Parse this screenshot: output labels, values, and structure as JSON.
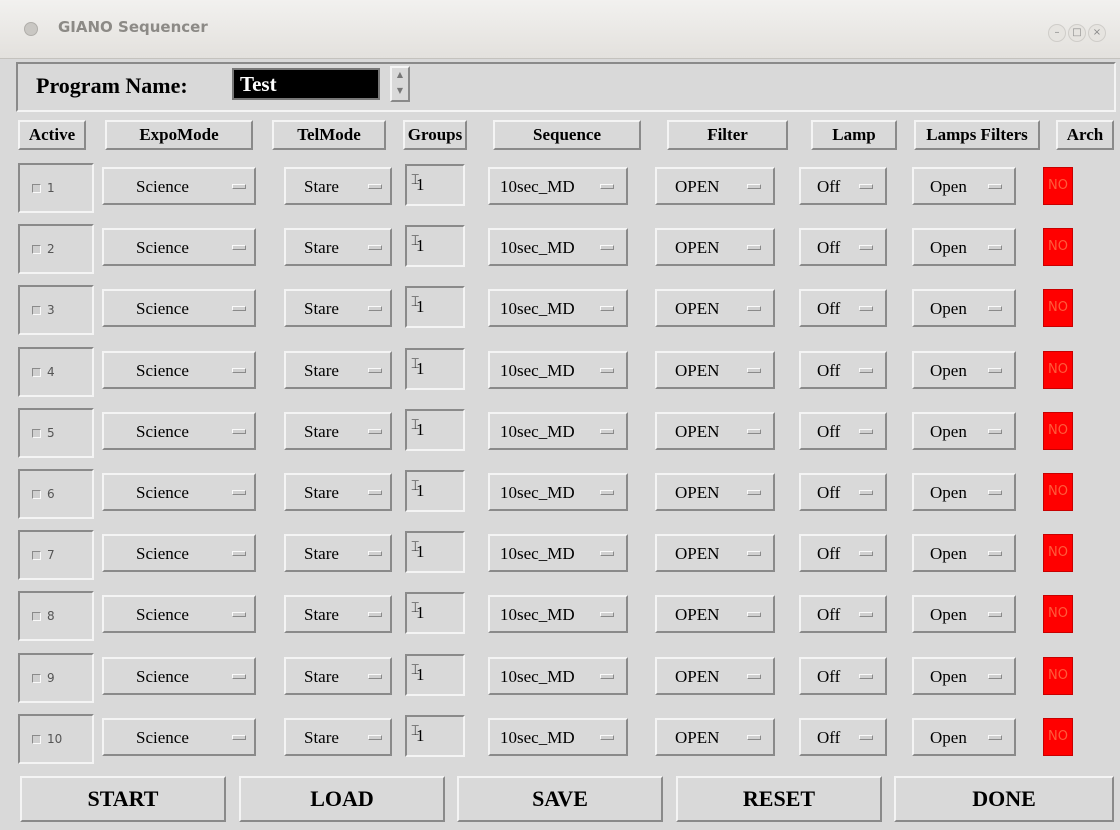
{
  "window": {
    "title": "GIANO Sequencer",
    "controls": [
      "–",
      "□",
      "×"
    ]
  },
  "program": {
    "label": "Program Name:",
    "value": "Test"
  },
  "headers": {
    "active": "Active",
    "expomode": "ExpoMode",
    "telmode": "TelMode",
    "groups": "Groups",
    "sequence": "Sequence",
    "filter": "Filter",
    "lamp": "Lamp",
    "lamps_filters": "Lamps Filters",
    "arch": "Arch"
  },
  "rows": [
    {
      "num": "1",
      "expomode": "Science",
      "telmode": "Stare",
      "groups": "1",
      "sequence": "10sec_MD",
      "filter": "OPEN",
      "lamp": "Off",
      "lamps_filters": "Open",
      "arch": "NO"
    },
    {
      "num": "2",
      "expomode": "Science",
      "telmode": "Stare",
      "groups": "1",
      "sequence": "10sec_MD",
      "filter": "OPEN",
      "lamp": "Off",
      "lamps_filters": "Open",
      "arch": "NO"
    },
    {
      "num": "3",
      "expomode": "Science",
      "telmode": "Stare",
      "groups": "1",
      "sequence": "10sec_MD",
      "filter": "OPEN",
      "lamp": "Off",
      "lamps_filters": "Open",
      "arch": "NO"
    },
    {
      "num": "4",
      "expomode": "Science",
      "telmode": "Stare",
      "groups": "1",
      "sequence": "10sec_MD",
      "filter": "OPEN",
      "lamp": "Off",
      "lamps_filters": "Open",
      "arch": "NO"
    },
    {
      "num": "5",
      "expomode": "Science",
      "telmode": "Stare",
      "groups": "1",
      "sequence": "10sec_MD",
      "filter": "OPEN",
      "lamp": "Off",
      "lamps_filters": "Open",
      "arch": "NO"
    },
    {
      "num": "6",
      "expomode": "Science",
      "telmode": "Stare",
      "groups": "1",
      "sequence": "10sec_MD",
      "filter": "OPEN",
      "lamp": "Off",
      "lamps_filters": "Open",
      "arch": "NO"
    },
    {
      "num": "7",
      "expomode": "Science",
      "telmode": "Stare",
      "groups": "1",
      "sequence": "10sec_MD",
      "filter": "OPEN",
      "lamp": "Off",
      "lamps_filters": "Open",
      "arch": "NO"
    },
    {
      "num": "8",
      "expomode": "Science",
      "telmode": "Stare",
      "groups": "1",
      "sequence": "10sec_MD",
      "filter": "OPEN",
      "lamp": "Off",
      "lamps_filters": "Open",
      "arch": "NO"
    },
    {
      "num": "9",
      "expomode": "Science",
      "telmode": "Stare",
      "groups": "1",
      "sequence": "10sec_MD",
      "filter": "OPEN",
      "lamp": "Off",
      "lamps_filters": "Open",
      "arch": "NO"
    },
    {
      "num": "10",
      "expomode": "Science",
      "telmode": "Stare",
      "groups": "1",
      "sequence": "10sec_MD",
      "filter": "OPEN",
      "lamp": "Off",
      "lamps_filters": "Open",
      "arch": "NO"
    }
  ],
  "actions": {
    "start": "START",
    "load": "LOAD",
    "save": "SAVE",
    "reset": "RESET",
    "done": "DONE"
  },
  "colors": {
    "background": "#d9d9d9",
    "arch_no": "#ff0000",
    "program_input_bg": "#000000"
  }
}
